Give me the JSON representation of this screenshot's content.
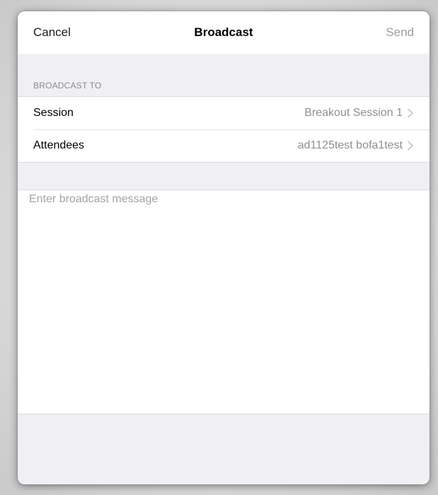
{
  "navbar": {
    "cancel_label": "Cancel",
    "title": "Broadcast",
    "send_label": "Send"
  },
  "broadcast_to": {
    "header": "BROADCAST TO",
    "rows": [
      {
        "label": "Session",
        "value": "Breakout Session 1"
      },
      {
        "label": "Attendees",
        "value": "ad1125test bofa1test"
      }
    ]
  },
  "message": {
    "placeholder": "Enter broadcast message",
    "value": ""
  },
  "colors": {
    "background": "#efeff4",
    "surface": "#ffffff",
    "secondary_text": "#8e8e93",
    "disabled_action": "#9b9b9f"
  },
  "icons": {
    "row_disclosure": "chevron-right-icon"
  }
}
